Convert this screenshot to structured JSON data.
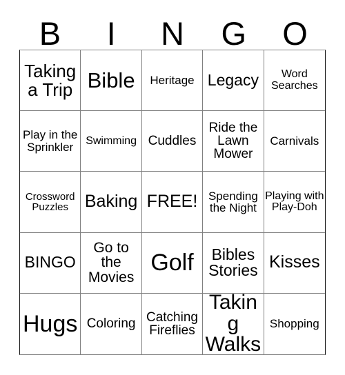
{
  "card": {
    "type": "bingo-card",
    "header_letters": [
      "B",
      "I",
      "N",
      "G",
      "O"
    ],
    "columns": 5,
    "rows": 5,
    "free_space": "FREE!",
    "colors": {
      "background": "#ffffff",
      "text": "#000000",
      "grid_line": "#808080",
      "grid_outer": "#1a1a1a"
    },
    "cells": [
      {
        "text": "Taking a Trip",
        "size": "fs-26"
      },
      {
        "text": "Bible",
        "size": "fs-31"
      },
      {
        "text": "Heritage",
        "size": "fs-17"
      },
      {
        "text": "Legacy",
        "size": "fs-23"
      },
      {
        "text": "Word Searches",
        "size": "fs-16"
      },
      {
        "text": "Play in the Sprinkler",
        "size": "fs-17"
      },
      {
        "text": "Swimming",
        "size": "fs-16"
      },
      {
        "text": "Cuddles",
        "size": "fs-19"
      },
      {
        "text": "Ride the Lawn Mower",
        "size": "fs-19"
      },
      {
        "text": "Carnivals",
        "size": "fs-17"
      },
      {
        "text": "Crossword Puzzles",
        "size": "fs-15"
      },
      {
        "text": "Baking",
        "size": "fs-25"
      },
      {
        "text": "FREE!",
        "size": "fs-25"
      },
      {
        "text": "Spending the Night",
        "size": "fs-17"
      },
      {
        "text": "Playing with Play-Doh",
        "size": "fs-16"
      },
      {
        "text": "BINGO",
        "size": "fs-23"
      },
      {
        "text": "Go to the Movies",
        "size": "fs-21"
      },
      {
        "text": "Golf",
        "size": "fs-34"
      },
      {
        "text": "Bibles Stories",
        "size": "fs-23"
      },
      {
        "text": "Kisses",
        "size": "fs-25"
      },
      {
        "text": "Hugs",
        "size": "fs-34"
      },
      {
        "text": "Coloring",
        "size": "fs-19"
      },
      {
        "text": "Catching Fireflies",
        "size": "fs-19"
      },
      {
        "text": "Taking Walks",
        "size": "fs-30"
      },
      {
        "text": "Shopping",
        "size": "fs-17"
      }
    ]
  }
}
